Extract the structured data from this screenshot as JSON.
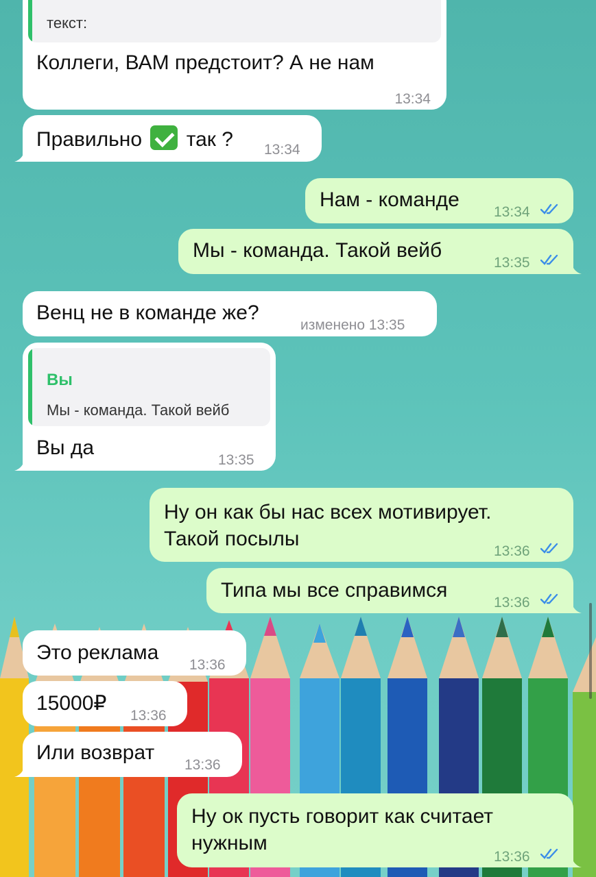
{
  "messages": [
    {
      "id": "m0",
      "direction": "in",
      "quote_partial": "текст:",
      "text": "Коллеги, ВАМ предстоит? А не нам",
      "time": "13:34"
    },
    {
      "id": "m1",
      "direction": "in",
      "text_before": "Правильно",
      "emoji": "check-mark-button",
      "text_after": "так ?",
      "time": "13:34"
    },
    {
      "id": "m2",
      "direction": "out",
      "text": "Нам - команде",
      "time": "13:34",
      "read": true
    },
    {
      "id": "m3",
      "direction": "out",
      "text": "Мы - команда. Такой вейб",
      "time": "13:35",
      "read": true
    },
    {
      "id": "m4",
      "direction": "in",
      "text": "Венц не в команде же?",
      "time": "изменено 13:35"
    },
    {
      "id": "m5",
      "direction": "in",
      "quote": {
        "author": "Вы",
        "text": "Мы - команда. Такой вейб"
      },
      "text": "Вы да",
      "time": "13:35"
    },
    {
      "id": "m6",
      "direction": "out",
      "lines": [
        "Ну он как бы нас всех мотивирует.",
        "Такой посылы"
      ],
      "time": "13:36",
      "read": true
    },
    {
      "id": "m7",
      "direction": "out",
      "text": "Типа мы все справимся",
      "time": "13:36",
      "read": true
    },
    {
      "id": "m8",
      "direction": "in",
      "text": "Это реклама",
      "time": "13:36"
    },
    {
      "id": "m9",
      "direction": "in",
      "text": "15000₽",
      "time": "13:36"
    },
    {
      "id": "m10",
      "direction": "in",
      "text": "Или возврат",
      "time": "13:36"
    },
    {
      "id": "m11",
      "direction": "out",
      "lines": [
        "Ну ок пусть говорит как считает",
        "нужным"
      ],
      "time": "13:36",
      "read": true
    }
  ],
  "colors": {
    "incoming_bubble": "#ffffff",
    "outgoing_bubble": "#dcfcca",
    "quote_accent": "#2fc06a",
    "read_check": "#3b8de8"
  }
}
